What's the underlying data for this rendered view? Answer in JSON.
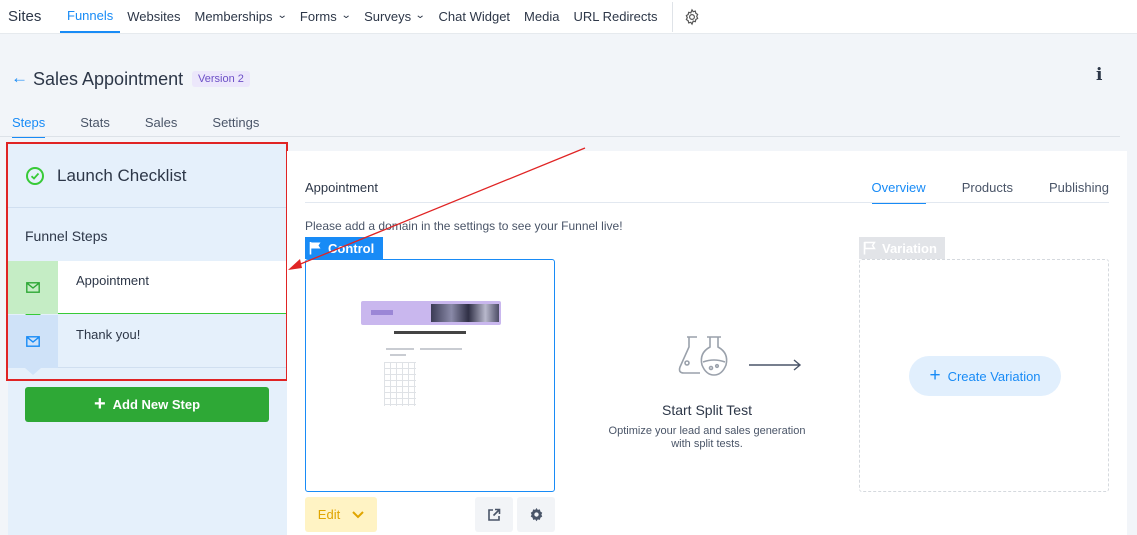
{
  "topnav": {
    "brand": "Sites",
    "items": [
      {
        "label": "Funnels",
        "active": true,
        "has_dropdown": false
      },
      {
        "label": "Websites",
        "active": false,
        "has_dropdown": false
      },
      {
        "label": "Memberships",
        "active": false,
        "has_dropdown": true
      },
      {
        "label": "Forms",
        "active": false,
        "has_dropdown": true
      },
      {
        "label": "Surveys",
        "active": false,
        "has_dropdown": true
      },
      {
        "label": "Chat Widget",
        "active": false,
        "has_dropdown": false
      },
      {
        "label": "Media",
        "active": false,
        "has_dropdown": false
      },
      {
        "label": "URL Redirects",
        "active": false,
        "has_dropdown": false
      }
    ],
    "settings_icon": "gear-icon"
  },
  "header": {
    "back_icon": "arrow-left-icon",
    "title": "Sales Appointment",
    "version_badge": "Version 2",
    "info_icon": "info-icon",
    "tabs": [
      {
        "label": "Steps",
        "active": true
      },
      {
        "label": "Stats",
        "active": false
      },
      {
        "label": "Sales",
        "active": false
      },
      {
        "label": "Settings",
        "active": false
      }
    ]
  },
  "sidebar": {
    "launch_checklist": "Launch Checklist",
    "steps_heading": "Funnel Steps",
    "steps": [
      {
        "label": "Appointment",
        "icon": "mail-icon",
        "active": true
      },
      {
        "label": "Thank you!",
        "icon": "mail-icon",
        "active": false
      }
    ],
    "add_step_label": "Add New Step"
  },
  "main": {
    "step_title": "Appointment",
    "tabs": [
      {
        "label": "Overview",
        "active": true
      },
      {
        "label": "Products",
        "active": false
      },
      {
        "label": "Publishing",
        "active": false
      }
    ],
    "domain_note": "Please add a domain in the settings to see your Funnel live!",
    "control_label": "Control",
    "edit_label": "Edit",
    "split_test_title": "Start Split Test",
    "split_test_desc": "Optimize your lead and sales generation with split tests.",
    "variation_label": "Variation",
    "create_variation_label": "Create Variation"
  },
  "colors": {
    "accent": "#188bf6",
    "success": "#37ca37",
    "add_button": "#2ea836",
    "annotation": "#e02424",
    "edit_bg": "#fff3c4",
    "version_bg": "#ece7fb"
  }
}
